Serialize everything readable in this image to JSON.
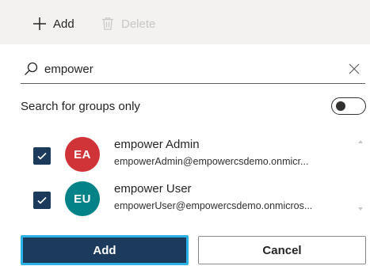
{
  "toolbar": {
    "add_label": "Add",
    "delete_label": "Delete",
    "add_icon": "plus-icon",
    "delete_icon": "trash-icon"
  },
  "search": {
    "value": "empower",
    "icon": "search-icon",
    "clear_icon": "close-icon"
  },
  "groups_only": {
    "label": "Search for groups only",
    "enabled": false
  },
  "results": [
    {
      "initials": "EA",
      "name": "empower Admin",
      "email": "empowerAdmin@empowercsdemo.onmicr...",
      "avatar_color": "#d13438",
      "checked": true
    },
    {
      "initials": "EU",
      "name": "empower User",
      "email": "empowerUser@empowercsdemo.onmicros...",
      "avatar_color": "#038387",
      "checked": true
    }
  ],
  "actions": {
    "primary_label": "Add",
    "secondary_label": "Cancel"
  },
  "colors": {
    "primary": "#1b3a5c",
    "focus_ring": "#2bb0e8",
    "disabled_text": "#c8c6c4"
  }
}
